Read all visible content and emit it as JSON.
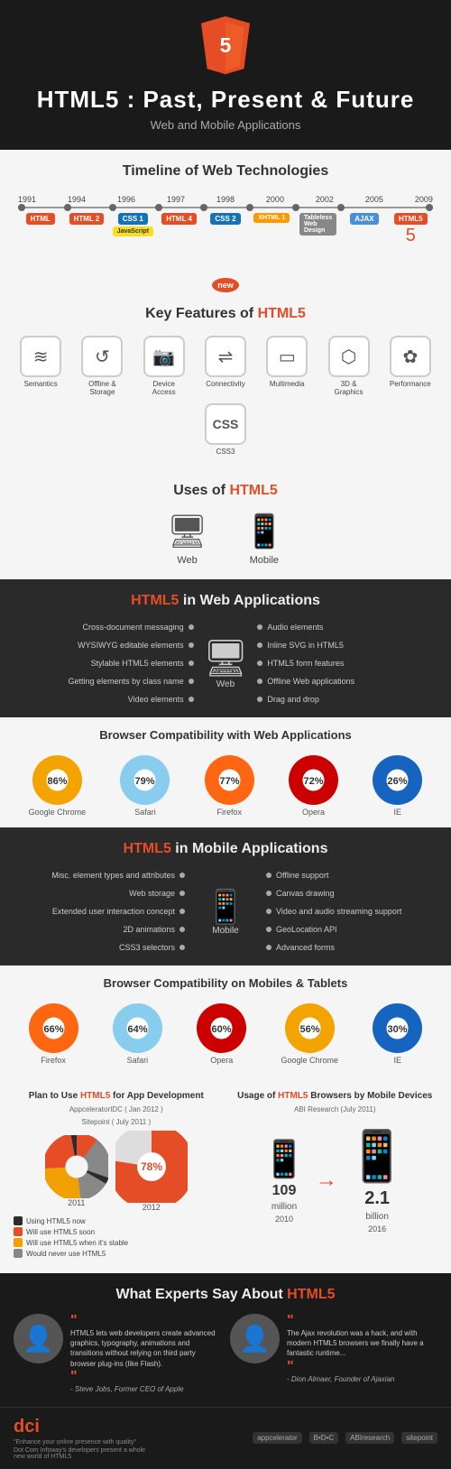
{
  "header": {
    "title": "HTML5 :  Past, Present & Future",
    "subtitle": "Web and Mobile Applications",
    "html5_label": "HTML5"
  },
  "timeline": {
    "section_title": "Timeline of Web Technologies",
    "years": [
      "1991",
      "1994",
      "1996",
      "1997",
      "1998",
      "2000",
      "2002",
      "2005",
      "2009"
    ],
    "tags": [
      {
        "label": "HTML",
        "color": "html"
      },
      {
        "label": "HTML 2",
        "color": "html2"
      },
      {
        "label": "CSS 1",
        "color": "css1"
      },
      {
        "label": "JavaScript",
        "color": "js"
      },
      {
        "label": "HTML 4",
        "color": "html4"
      },
      {
        "label": "CSS 2",
        "color": "css2"
      },
      {
        "label": "XHTML 1",
        "color": "xhtml"
      },
      {
        "label": "Tableless Web Design",
        "color": "tableless"
      },
      {
        "label": "AJAX",
        "color": "ajax"
      },
      {
        "label": "HTML5",
        "color": "html5"
      }
    ]
  },
  "key_features": {
    "section_title_prefix": "Key Features of ",
    "section_title_highlight": "HTML5",
    "features": [
      {
        "label": "Semantics",
        "icon": "≋"
      },
      {
        "label": "Offline & Storage",
        "icon": "↺"
      },
      {
        "label": "Device Access",
        "icon": "▣"
      },
      {
        "label": "Connectivity",
        "icon": "⇌"
      },
      {
        "label": "Multimedia",
        "icon": "▭"
      },
      {
        "label": "3D & Graphics",
        "icon": "⬡"
      },
      {
        "label": "Performance",
        "icon": "✿"
      },
      {
        "label": "CSS3",
        "icon": "Ξ"
      }
    ]
  },
  "uses": {
    "section_title_prefix": "Uses of ",
    "section_title_highlight": "HTML5",
    "web_label": "Web",
    "mobile_label": "Mobile"
  },
  "web_apps": {
    "section_title_prefix": "HTML5",
    "section_title_suffix": " in Web Applications",
    "left_features": [
      "Cross-document messaging",
      "WYSIWYG editable elements",
      "Stylable HTML5 elements",
      "Getting elements by class name",
      "Video elements"
    ],
    "right_features": [
      "Audio elements",
      "Inline SVG in HTML5",
      "HTML5 form features",
      "Offline Web applications",
      "Drag and drop"
    ],
    "center_label": "Web"
  },
  "browser_compat_web": {
    "section_title": "Browser Compatibility with Web Applications",
    "browsers": [
      {
        "name": "Google Chrome",
        "pct": "86%",
        "color": "#f4a400"
      },
      {
        "name": "Safari",
        "pct": "79%",
        "color": "#88ccee"
      },
      {
        "name": "Firefox",
        "pct": "77%",
        "color": "#ff6611"
      },
      {
        "name": "Opera",
        "pct": "72%",
        "color": "#cc0000"
      },
      {
        "name": "IE",
        "pct": "26%",
        "color": "#1565c0"
      }
    ]
  },
  "mobile_apps": {
    "section_title_prefix": "HTML5",
    "section_title_suffix": " in Mobile Applications",
    "left_features": [
      "Misc. element types and attributes",
      "Web storage",
      "Extended user interaction concept",
      "2D animations",
      "CSS3 selectors"
    ],
    "right_features": [
      "Offline support",
      "Canvas drawing",
      "Video and audio streaming support",
      "GeoLocation API",
      "Advanced forms"
    ],
    "center_label": "Mobile"
  },
  "browser_compat_mobile": {
    "section_title": "Browser Compatibility on Mobiles & Tablets",
    "browsers": [
      {
        "name": "Firefox",
        "pct": "66%",
        "color": "#ff6611"
      },
      {
        "name": "Safari",
        "pct": "64%",
        "color": "#88ccee"
      },
      {
        "name": "Opera",
        "pct": "60%",
        "color": "#cc0000"
      },
      {
        "name": "Google Chrome",
        "pct": "56%",
        "color": "#f4a400"
      },
      {
        "name": "IE",
        "pct": "30%",
        "color": "#1565c0"
      }
    ]
  },
  "plan_section": {
    "title_prefix": "Plan to Use ",
    "title_highlight": "HTML5",
    "title_suffix": " for App Development",
    "source": "AppceleratorIDC ( Jan 2012 )",
    "source2": "Sitepoint ( July 2011 )",
    "pie2011": {
      "year": "2011",
      "segments": [
        {
          "label": "Using HTML5 now",
          "color": "#2c2c2c",
          "pct": 3
        },
        {
          "label": "Will use HTML5 soon",
          "color": "#e44d26",
          "pct": 23
        },
        {
          "label": "Will use HTML5 when it's stable",
          "color": "#f0a000",
          "pct": 26
        },
        {
          "label": "Would never use HTML5",
          "color": "#888",
          "pct": 48
        }
      ]
    },
    "pie2012": {
      "year": "2012",
      "big_pct": "78%",
      "color": "#e44d26"
    },
    "legend": [
      {
        "label": "Using HTML5 now",
        "color": "#2c2c2c"
      },
      {
        "label": "Will use HTML5 soon",
        "color": "#e44d26"
      },
      {
        "label": "Will use HTML5 when it's stable",
        "color": "#f0a000"
      },
      {
        "label": "Would never use HTML5",
        "color": "#888"
      }
    ]
  },
  "usage_section": {
    "title_prefix": "Usage of ",
    "title_highlight": "HTML5",
    "title_suffix": " Browsers by Mobile Devices",
    "source": "ABI Research (July 2011)",
    "year1": "2010",
    "value1": "109",
    "unit1": "million",
    "year2": "2016",
    "value2": "2.1",
    "unit2": "billion"
  },
  "experts": {
    "section_title_prefix": "What Experts Say About ",
    "section_title_highlight": "HTML5",
    "quotes": [
      {
        "text": "HTML5 lets web developers create advanced graphics, typography, animations and transitions without relying on third party browser plug-ins (like Flash).",
        "author": "- Steve Jobs, Former CEO of Apple"
      },
      {
        "text": "The Ajax revolution was a hack, and with modern HTML5 browsers we finally have a fantastic runtime...",
        "author": "- Dion Almaer, Founder of Ajaxian"
      }
    ]
  },
  "footer": {
    "logo": "dci",
    "tagline": "\"Enhance your online presence with quality\"",
    "subtext": "Dot Com Infoway's developers present a whole new world of HTML5",
    "brands": [
      "appcelerator",
      "B•D•C",
      "ABIresearch",
      "sitepoint"
    ]
  }
}
